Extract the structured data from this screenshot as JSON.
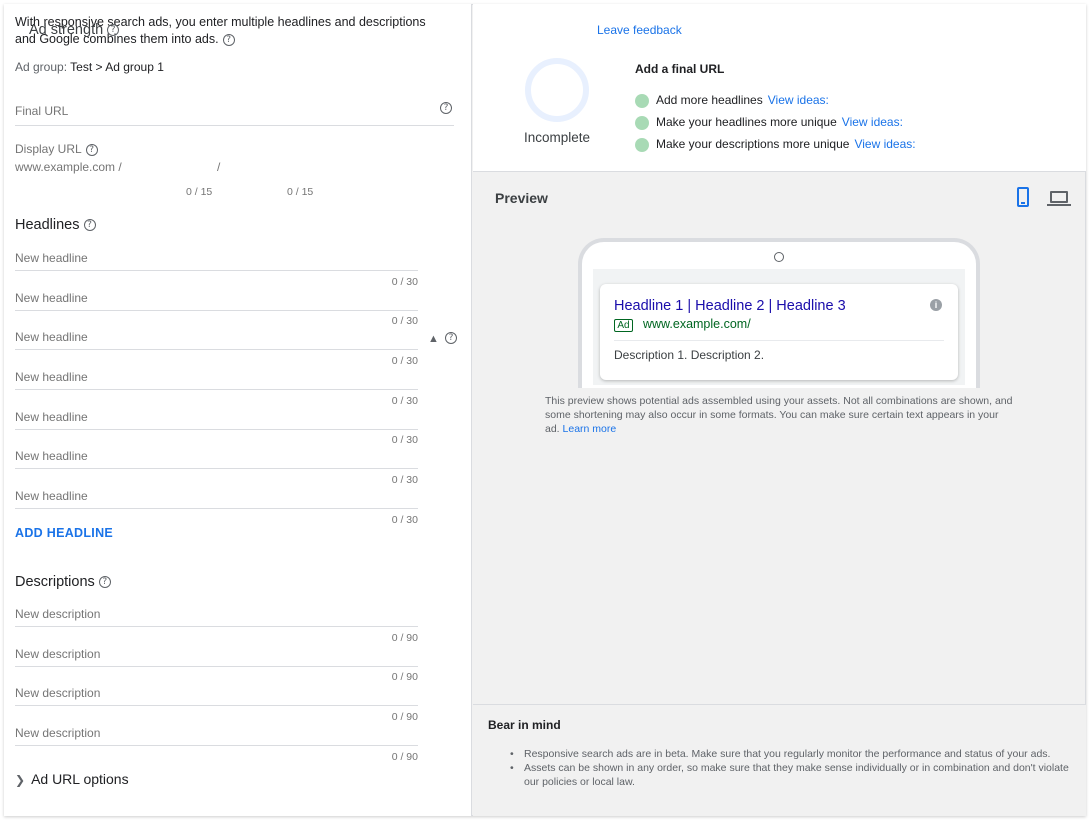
{
  "intro": {
    "text": "With responsive search ads, you enter multiple headlines and descriptions and Google combines them into ads."
  },
  "adgroup": {
    "label": "Ad group:",
    "value": "Test > Ad group 1"
  },
  "final_url": {
    "placeholder": "Final URL"
  },
  "display_url": {
    "label": "Display URL",
    "domain": "www.example.com /",
    "slash": "/",
    "path1_count": "0 / 15",
    "path2_count": "0 / 15"
  },
  "headlines": {
    "title": "Headlines",
    "items": [
      {
        "placeholder": "New headline",
        "count": "0 / 30"
      },
      {
        "placeholder": "New headline",
        "count": "0 / 30"
      },
      {
        "placeholder": "New headline",
        "count": "0 / 30"
      },
      {
        "placeholder": "New headline",
        "count": "0 / 30"
      },
      {
        "placeholder": "New headline",
        "count": "0 / 30"
      },
      {
        "placeholder": "New headline",
        "count": "0 / 30"
      },
      {
        "placeholder": "New headline",
        "count": "0 / 30"
      }
    ],
    "add_label": "ADD HEADLINE"
  },
  "descriptions": {
    "title": "Descriptions",
    "items": [
      {
        "placeholder": "New description",
        "count": "0 / 90"
      },
      {
        "placeholder": "New description",
        "count": "0 / 90"
      },
      {
        "placeholder": "New description",
        "count": "0 / 90"
      },
      {
        "placeholder": "New description",
        "count": "0 / 90"
      }
    ]
  },
  "url_options": {
    "label": "Ad URL options"
  },
  "ad_strength": {
    "title": "Ad strength",
    "feedback_link": "Leave feedback",
    "status": "Incomplete",
    "tips_title": "Add a final URL",
    "tips": [
      {
        "text": "Add more headlines",
        "link": "View ideas:"
      },
      {
        "text": "Make your headlines more unique",
        "link": "View ideas:"
      },
      {
        "text": "Make your descriptions more unique",
        "link": "View ideas:"
      }
    ]
  },
  "preview": {
    "title": "Preview",
    "ad_headline": "Headline 1 | Headline 2 | Headline 3",
    "ad_badge": "Ad",
    "ad_url": "www.example.com/",
    "ad_description": "Description 1. Description 2.",
    "note": "This preview shows potential ads assembled using your assets. Not all combinations are shown, and some shortening may also occur in some formats. You can make sure certain text appears in your ad.",
    "learn_more": "Learn more"
  },
  "bear_in_mind": {
    "title": "Bear in mind",
    "items": [
      "Responsive search ads are in beta. Make sure that you regularly monitor the performance and status of your ads.",
      "Assets can be shown in any order, so make sure that they make sense individually or in combination and don't violate our policies or local law."
    ]
  },
  "colors": {
    "accent": "#1a73e8",
    "ad_link": "#1a0dab",
    "ad_url": "#006621",
    "strength_dot": "#a8dab5"
  }
}
